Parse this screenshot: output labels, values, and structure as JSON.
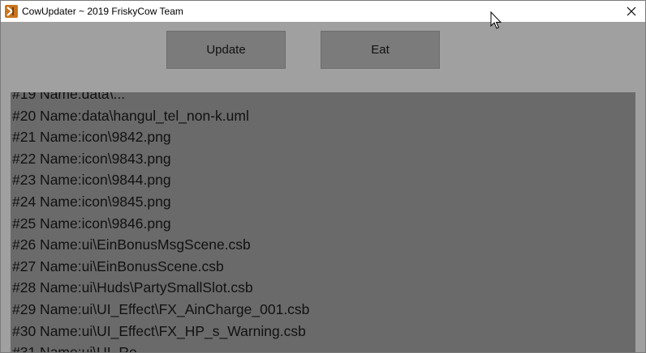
{
  "window": {
    "title": "CowUpdater ~ 2019 FriskyCow Team"
  },
  "toolbar": {
    "update_label": "Update",
    "eat_label": "Eat"
  },
  "log": {
    "lines": [
      "#19 Name:data\\...",
      "#20 Name:data\\hangul_tel_non-k.uml",
      "#21 Name:icon\\9842.png",
      "#22 Name:icon\\9843.png",
      "#23 Name:icon\\9844.png",
      "#24 Name:icon\\9845.png",
      "#25 Name:icon\\9846.png",
      "#26 Name:ui\\EinBonusMsgScene.csb",
      "#27 Name:ui\\EinBonusScene.csb",
      "#28 Name:ui\\Huds\\PartySmallSlot.csb",
      "#29 Name:ui\\UI_Effect\\FX_AinCharge_001.csb",
      "#30 Name:ui\\UI_Effect\\FX_HP_s_Warning.csb",
      "#31 Name:ui\\UI_Re"
    ]
  },
  "colors": {
    "background": "#a0a0a0",
    "button": "#7b7b7b",
    "log_panel": "#6a6a6a",
    "app_icon": "#c9741e"
  },
  "icons": {
    "app": "cow-app-icon",
    "close": "close-icon",
    "cursor": "mouse-cursor-icon"
  }
}
